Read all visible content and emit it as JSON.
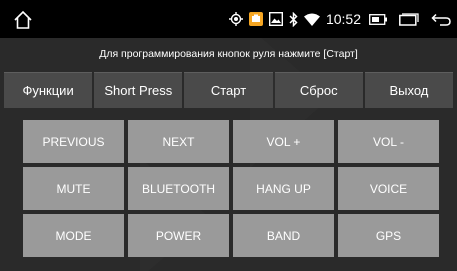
{
  "status_bar": {
    "time": "10:52",
    "icons": [
      "home-icon",
      "location-icon",
      "app-notification-icon",
      "image-notification-icon",
      "bluetooth-icon",
      "wifi-icon",
      "battery-icon",
      "recent-apps-icon",
      "back-icon"
    ],
    "notification_color": "#f5a623"
  },
  "hint_text": "Для программирования кнопок руля нажмите [Старт]",
  "tabs": [
    {
      "label": "Функции"
    },
    {
      "label": "Short Press"
    },
    {
      "label": "Старт"
    },
    {
      "label": "Сброс"
    },
    {
      "label": "Выход"
    }
  ],
  "keys": [
    {
      "label": "PREVIOUS"
    },
    {
      "label": "NEXT"
    },
    {
      "label": "VOL +"
    },
    {
      "label": "VOL -"
    },
    {
      "label": "MUTE"
    },
    {
      "label": "BLUETOOTH"
    },
    {
      "label": "HANG UP"
    },
    {
      "label": "VOICE"
    },
    {
      "label": "MODE"
    },
    {
      "label": "POWER"
    },
    {
      "label": "BAND"
    },
    {
      "label": "GPS"
    }
  ]
}
